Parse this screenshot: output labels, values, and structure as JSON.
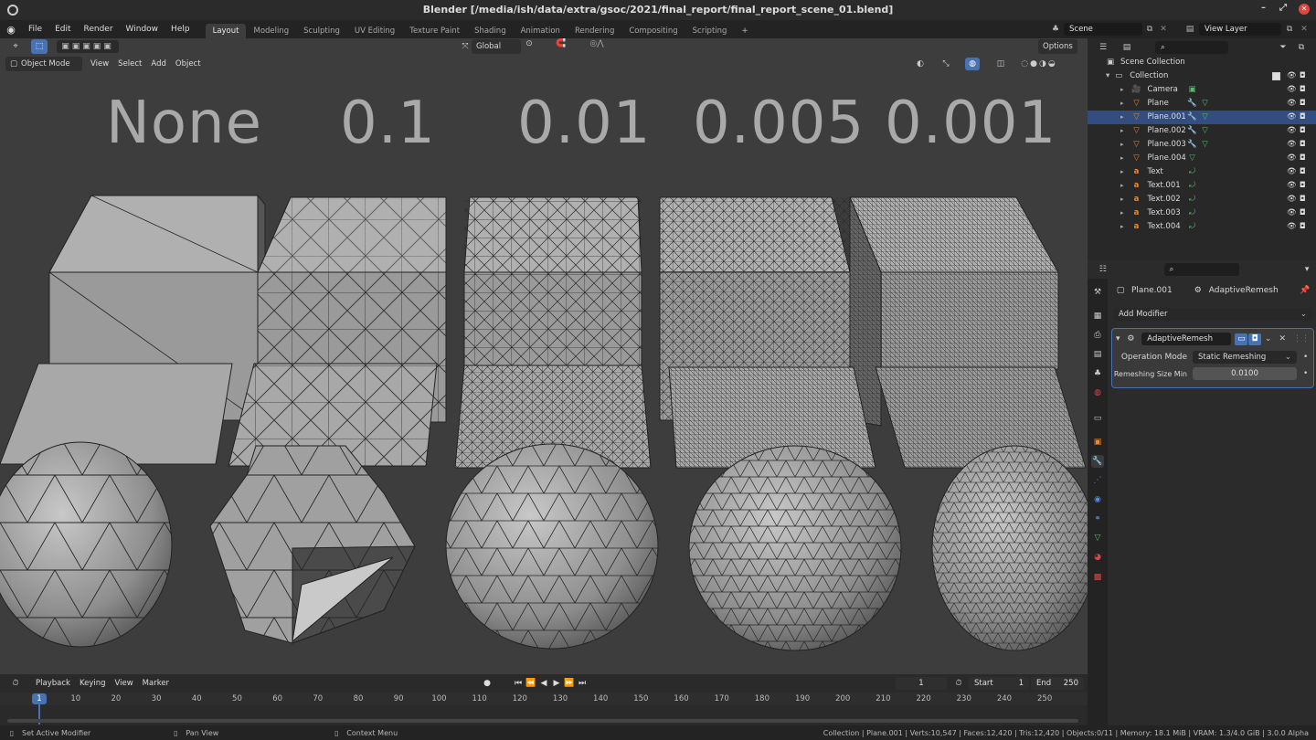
{
  "window": {
    "title": "Blender [/media/ish/data/extra/gsoc/2021/final_report/final_report_scene_01.blend]"
  },
  "menus": [
    "File",
    "Edit",
    "Render",
    "Window",
    "Help"
  ],
  "workspaces": [
    "Layout",
    "Modeling",
    "Sculpting",
    "UV Editing",
    "Texture Paint",
    "Shading",
    "Animation",
    "Rendering",
    "Compositing",
    "Scripting"
  ],
  "active_workspace": "Layout",
  "scene": {
    "name": "Scene",
    "view_layer": "View Layer"
  },
  "toolheader": {
    "orientation": "Global",
    "options": "Options"
  },
  "viewport_header": {
    "mode": "Object Mode",
    "menus": [
      "View",
      "Select",
      "Add",
      "Object"
    ]
  },
  "viewport_labels": [
    "None",
    "0.1",
    "0.01",
    "0.005",
    "0.001"
  ],
  "outliner": {
    "root": "Scene Collection",
    "collection": "Collection",
    "items": [
      "Camera",
      "Plane",
      "Plane.001",
      "Plane.002",
      "Plane.003",
      "Plane.004",
      "Text",
      "Text.001",
      "Text.002",
      "Text.003",
      "Text.004"
    ]
  },
  "properties": {
    "object": "Plane.001",
    "modifier_crumb": "AdaptiveRemesh",
    "add_modifier": "Add Modifier",
    "modifier": {
      "name": "AdaptiveRemesh",
      "operation_mode_label": "Operation Mode",
      "operation_mode_value": "Static Remeshing",
      "size_min_label": "Remeshing Size Min",
      "size_min_value": "0.0100"
    }
  },
  "timeline": {
    "menus": [
      "Playback",
      "Keying",
      "View",
      "Marker"
    ],
    "current_frame": "1",
    "start_label": "Start",
    "start": "1",
    "end_label": "End",
    "end": "250",
    "ruler": [
      "1",
      "10",
      "20",
      "30",
      "40",
      "50",
      "60",
      "70",
      "80",
      "90",
      "100",
      "110",
      "120",
      "130",
      "140",
      "150",
      "160",
      "170",
      "180",
      "190",
      "200",
      "210",
      "220",
      "230",
      "240",
      "250"
    ]
  },
  "status_bar": {
    "left": "Set Active Modifier",
    "middle": "Pan View",
    "right": "Context Menu",
    "stats": "Collection | Plane.001 | Verts:10,547 | Faces:12,420 | Tris:12,420 | Objects:0/11 | Memory: 18.1 MiB | VRAM: 1.3/4.0 GiB | 3.0.0 Alpha"
  }
}
